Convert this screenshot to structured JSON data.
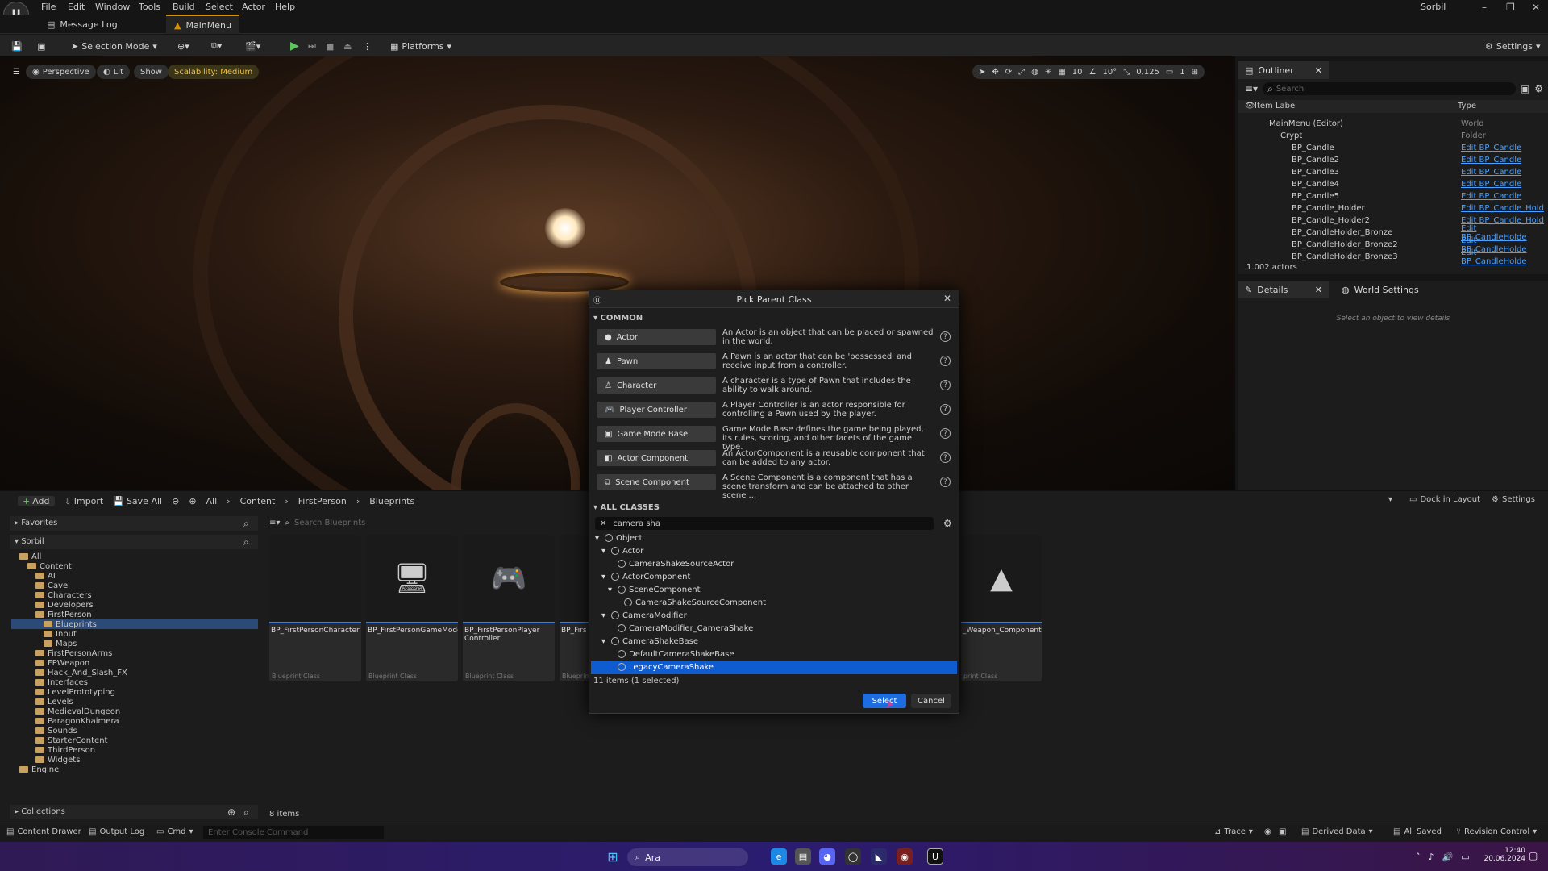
{
  "menu": [
    "File",
    "Edit",
    "Window",
    "Tools",
    "Build",
    "Select",
    "Actor",
    "Help"
  ],
  "user": "Sorbil",
  "tabs": {
    "message_log": "Message Log",
    "main_menu": "MainMenu"
  },
  "toolbar": {
    "selection_mode": "Selection Mode",
    "platforms": "Platforms",
    "settings": "Settings"
  },
  "viewport": {
    "perspective": "Perspective",
    "lit": "Lit",
    "show": "Show",
    "scalability": "Scalability: Medium",
    "grid": "10",
    "angle": "10°",
    "scale": "0,125",
    "cam": "1"
  },
  "outliner": {
    "title": "Outliner",
    "search_placeholder": "Search",
    "col_label": "Item Label",
    "col_type": "Type",
    "rows": [
      {
        "name": "MainMenu (Editor)",
        "type": "World"
      },
      {
        "name": "Crypt",
        "type": "Folder"
      },
      {
        "name": "BP_Candle",
        "type": "Edit BP_Candle"
      },
      {
        "name": "BP_Candle2",
        "type": "Edit BP_Candle"
      },
      {
        "name": "BP_Candle3",
        "type": "Edit BP_Candle"
      },
      {
        "name": "BP_Candle4",
        "type": "Edit BP_Candle"
      },
      {
        "name": "BP_Candle5",
        "type": "Edit BP_Candle"
      },
      {
        "name": "BP_Candle_Holder",
        "type": "Edit BP_Candle_Hold"
      },
      {
        "name": "BP_Candle_Holder2",
        "type": "Edit BP_Candle_Hold"
      },
      {
        "name": "BP_CandleHolder_Bronze",
        "type": "Edit BP_CandleHolde"
      },
      {
        "name": "BP_CandleHolder_Bronze2",
        "type": "Edit BP_CandleHolde"
      },
      {
        "name": "BP_CandleHolder_Bronze3",
        "type": "Edit BP_CandleHolde"
      }
    ],
    "count": "1.002 actors"
  },
  "details": {
    "title": "Details",
    "world_settings": "World Settings",
    "empty": "Select an object to view details"
  },
  "content_browser": {
    "add": "Add",
    "import": "Import",
    "save_all": "Save All",
    "crumbs": [
      "All",
      "Content",
      "FirstPerson",
      "Blueprints"
    ],
    "dock": "Dock in Layout",
    "settings": "Settings",
    "favorites": "Favorites",
    "root": "Sorbil",
    "search_placeholder": "Search Blueprints",
    "folders": [
      "All",
      "Content",
      "AI",
      "Cave",
      "Characters",
      "Developers",
      "FirstPerson",
      "Blueprints",
      "Input",
      "Maps",
      "FirstPersonArms",
      "FPWeapon",
      "Hack_And_Slash_FX",
      "Interfaces",
      "LevelPrototyping",
      "Levels",
      "MedievalDungeon",
      "ParagonKhaimera",
      "Sounds",
      "StarterContent",
      "ThirdPerson",
      "Widgets",
      "Engine"
    ],
    "collections": "Collections",
    "items_count": "8 items",
    "assets": [
      {
        "name": "BP_FirstPersonCharacter",
        "cls": "Blueprint Class"
      },
      {
        "name": "BP_FirstPersonGameMode",
        "cls": "Blueprint Class"
      },
      {
        "name": "BP_FirstPersonPlayer Controller",
        "cls": "Blueprint Class"
      },
      {
        "name": "BP_Firs",
        "cls": "Blueprin"
      },
      {
        "name": "_Weapon_Component",
        "cls": "print Class"
      }
    ]
  },
  "dialog": {
    "title": "Pick Parent Class",
    "common": "COMMON",
    "common_items": [
      {
        "label": "Actor",
        "desc": "An Actor is an object that can be placed or spawned in the world."
      },
      {
        "label": "Pawn",
        "desc": "A Pawn is an actor that can be 'possessed' and receive input from a controller."
      },
      {
        "label": "Character",
        "desc": "A character is a type of Pawn that includes the ability to walk around."
      },
      {
        "label": "Player Controller",
        "desc": "A Player Controller is an actor responsible for controlling a Pawn used by the player."
      },
      {
        "label": "Game Mode Base",
        "desc": "Game Mode Base defines the game being played, its rules, scoring, and other facets of the game type."
      },
      {
        "label": "Actor Component",
        "desc": "An ActorComponent is a reusable component that can be added to any actor."
      },
      {
        "label": "Scene Component",
        "desc": "A Scene Component is a component that has a scene transform and can be attached to other scene ..."
      }
    ],
    "all_classes": "ALL CLASSES",
    "search_value": "camera sha",
    "tree": [
      "Object",
      "Actor",
      "CameraShakeSourceActor",
      "ActorComponent",
      "SceneComponent",
      "CameraShakeSourceComponent",
      "CameraModifier",
      "CameraModifier_CameraShake",
      "CameraShakeBase",
      "DefaultCameraShakeBase",
      "LegacyCameraShake"
    ],
    "status": "11 items (1 selected)",
    "select": "Select",
    "cancel": "Cancel"
  },
  "statusbar": {
    "content_drawer": "Content Drawer",
    "output_log": "Output Log",
    "cmd": "Cmd",
    "console_placeholder": "Enter Console Command",
    "trace": "Trace",
    "derived": "Derived Data",
    "saved": "All Saved",
    "revision": "Revision Control"
  },
  "taskbar": {
    "search": "Ara",
    "time": "12:40",
    "date": "20.06.2024"
  }
}
